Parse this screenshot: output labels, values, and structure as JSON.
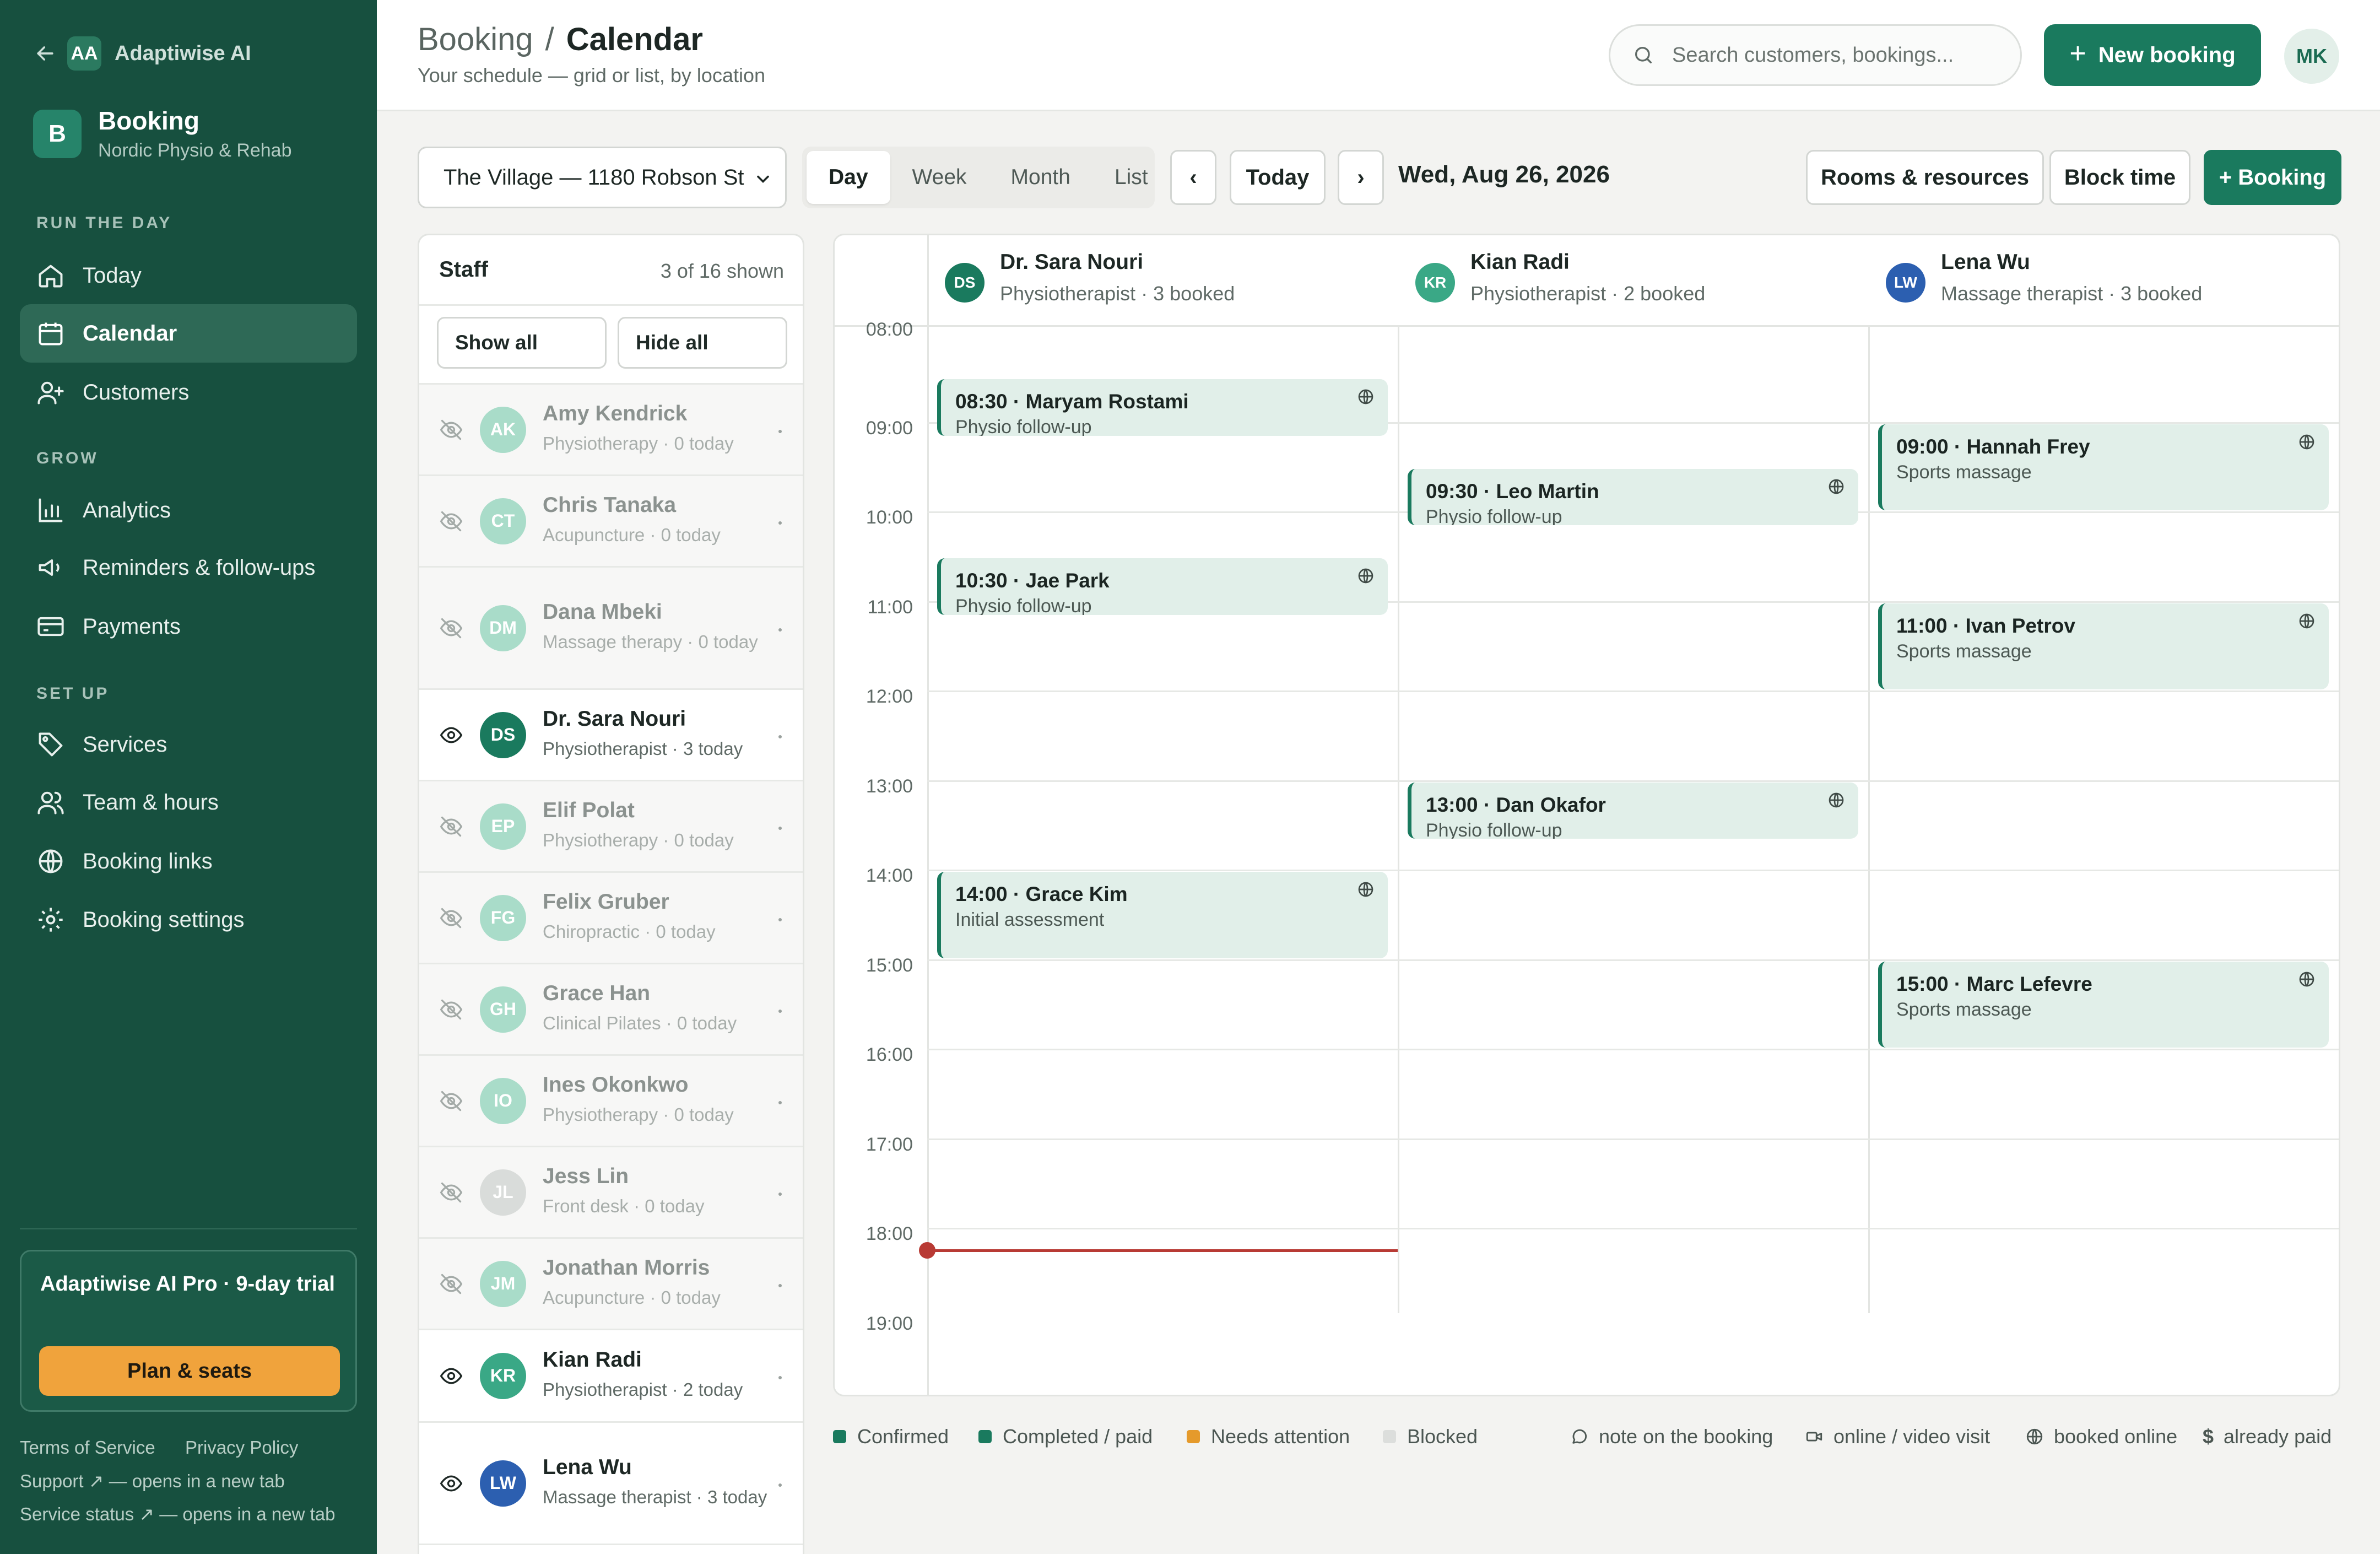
{
  "sidebar": {
    "brand_initials": "AA",
    "brand_name": "Adaptiwise AI",
    "app_initial": "B",
    "app_name": "Booking",
    "app_sub": "Nordic Physio & Rehab",
    "sections": {
      "run": "RUN THE DAY",
      "grow": "GROW",
      "setup": "SET UP"
    },
    "items": {
      "today": "Today",
      "calendar": "Calendar",
      "customers": "Customers",
      "analytics": "Analytics",
      "reminders": "Reminders & follow-ups",
      "payments": "Payments",
      "services": "Services",
      "team": "Team & hours",
      "links": "Booking links",
      "settings": "Booking settings"
    },
    "trial": {
      "title": "Adaptiwise AI Pro · 9-day trial",
      "button": "Plan & seats"
    },
    "footer": {
      "terms": "Terms of Service",
      "privacy": "Privacy Policy",
      "support": "Support ↗ — opens in a new tab",
      "status": "Service status ↗ — opens in a new tab"
    }
  },
  "header": {
    "crumb_parent": "Booking",
    "crumb_sep": "/",
    "crumb_current": "Calendar",
    "subtitle": "Your schedule — grid or list, by location",
    "search_placeholder": "Search customers, bookings...",
    "new_booking": "New booking",
    "user_initials": "MK"
  },
  "toolbar": {
    "location": "The Village — 1180 Robson St",
    "views": [
      "Day",
      "Week",
      "Month",
      "List"
    ],
    "active_view": "Day",
    "prev": "‹",
    "today": "Today",
    "next": "›",
    "date": "Wed, Aug 26, 2026",
    "rooms": "Rooms & resources",
    "block": "Block time",
    "booking": "+ Booking"
  },
  "staff": {
    "title": "Staff",
    "count": "3 of 16 shown",
    "show_all": "Show all",
    "hide_all": "Hide all",
    "members": [
      {
        "initials": "AK",
        "name": "Amy Kendrick",
        "role": "Physiotherapy · 0 today",
        "visible": false,
        "color": "#a9dcc9"
      },
      {
        "initials": "CT",
        "name": "Chris Tanaka",
        "role": "Acupuncture · 0 today",
        "visible": false,
        "color": "#a9dcc9"
      },
      {
        "initials": "DM",
        "name": "Dana Mbeki",
        "role": "Massage therapy · 0 today",
        "visible": false,
        "color": "#a9dcc9"
      },
      {
        "initials": "DS",
        "name": "Dr. Sara Nouri",
        "role": "Physiotherapist · 3 today",
        "visible": true,
        "color": "#1a7a5e"
      },
      {
        "initials": "EP",
        "name": "Elif Polat",
        "role": "Physiotherapy · 0 today",
        "visible": false,
        "color": "#a9dcc9"
      },
      {
        "initials": "FG",
        "name": "Felix Gruber",
        "role": "Chiropractic · 0 today",
        "visible": false,
        "color": "#a9dcc9"
      },
      {
        "initials": "GH",
        "name": "Grace Han",
        "role": "Clinical Pilates · 0 today",
        "visible": false,
        "color": "#a9dcc9"
      },
      {
        "initials": "IO",
        "name": "Ines Okonkwo",
        "role": "Physiotherapy · 0 today",
        "visible": false,
        "color": "#a9dcc9"
      },
      {
        "initials": "JL",
        "name": "Jess Lin",
        "role": "Front desk · 0 today",
        "visible": false,
        "color": "#d9dcda"
      },
      {
        "initials": "JM",
        "name": "Jonathan Morris",
        "role": "Acupuncture · 0 today",
        "visible": false,
        "color": "#a9dcc9"
      },
      {
        "initials": "KR",
        "name": "Kian Radi",
        "role": "Physiotherapist · 2 today",
        "visible": true,
        "color": "#3aa886"
      },
      {
        "initials": "LW",
        "name": "Lena Wu",
        "role": "Massage therapist · 3 today",
        "visible": true,
        "color": "#2c5fb0"
      }
    ]
  },
  "calendar": {
    "hours": [
      "08:00",
      "09:00",
      "10:00",
      "11:00",
      "12:00",
      "13:00",
      "14:00",
      "15:00",
      "16:00",
      "17:00",
      "18:00",
      "19:00"
    ],
    "now": "18:15",
    "columns": [
      {
        "initials": "DS",
        "name": "Dr. Sara Nouri",
        "sub": "Physiotherapist · 3 booked",
        "color": "#1a7a5e"
      },
      {
        "initials": "KR",
        "name": "Kian Radi",
        "sub": "Physiotherapist · 2 booked",
        "color": "#3aa886"
      },
      {
        "initials": "LW",
        "name": "Lena Wu",
        "sub": "Massage therapist · 3 booked",
        "color": "#2c5fb0"
      }
    ],
    "events": [
      {
        "col": 0,
        "start": "08:30",
        "end": "09:10",
        "title": "08:30 · Maryam Rostami",
        "sub": "Physio follow-up"
      },
      {
        "col": 0,
        "start": "10:30",
        "end": "11:10",
        "title": "10:30 · Jae Park",
        "sub": "Physio follow-up"
      },
      {
        "col": 0,
        "start": "14:00",
        "end": "15:00",
        "title": "14:00 · Grace Kim",
        "sub": "Initial assessment"
      },
      {
        "col": 1,
        "start": "09:30",
        "end": "10:10",
        "title": "09:30 · Leo Martin",
        "sub": "Physio follow-up"
      },
      {
        "col": 1,
        "start": "13:00",
        "end": "13:40",
        "title": "13:00 · Dan Okafor",
        "sub": "Physio follow-up"
      },
      {
        "col": 2,
        "start": "09:00",
        "end": "10:00",
        "title": "09:00 · Hannah Frey",
        "sub": "Sports massage"
      },
      {
        "col": 2,
        "start": "11:00",
        "end": "12:00",
        "title": "11:00 · Ivan Petrov",
        "sub": "Sports massage"
      },
      {
        "col": 2,
        "start": "15:00",
        "end": "16:00",
        "title": "15:00 · Marc Lefevre",
        "sub": "Sports massage"
      }
    ]
  },
  "legend": {
    "confirmed": "Confirmed",
    "completed": "Completed / paid",
    "attention": "Needs attention",
    "blocked": "Blocked",
    "note": "note on the booking",
    "online": "online / video visit",
    "booked_online": "booked online",
    "paid": "already paid",
    "paid_symbol": "$",
    "colors": {
      "confirmed": "#1a7a5e",
      "completed": "#1a7a5e",
      "attention": "#e59a2b",
      "blocked": "#dcdedc"
    }
  }
}
